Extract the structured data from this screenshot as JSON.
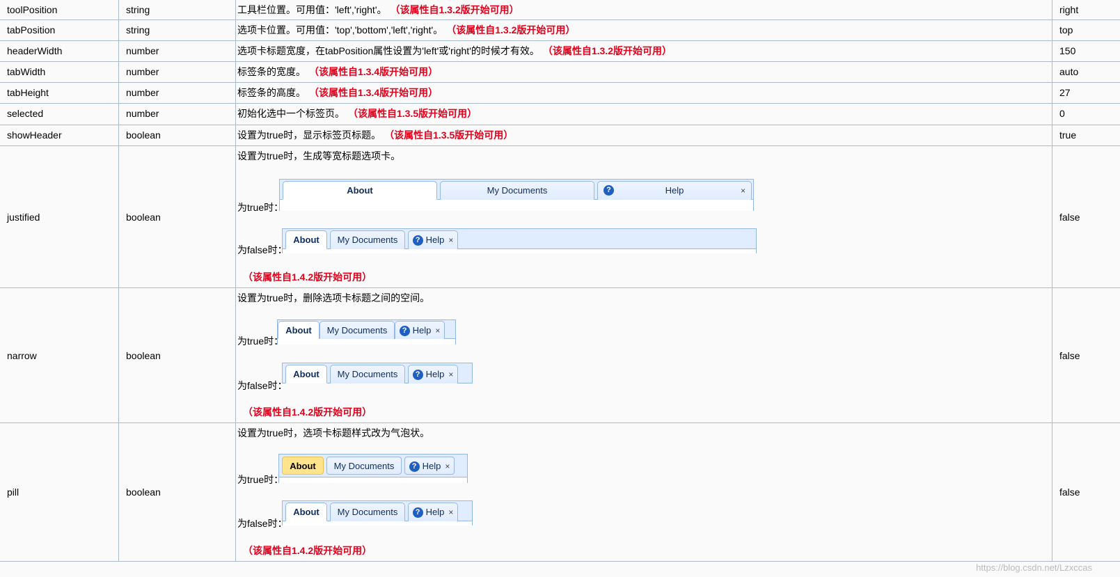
{
  "rows": [
    {
      "name": "toolPosition",
      "type": "string",
      "desc": "工具栏位置。可用值：'left','right'。",
      "note": "（该属性自1.3.2版开始可用）",
      "default": "right"
    },
    {
      "name": "tabPosition",
      "type": "string",
      "desc": "选项卡位置。可用值：'top','bottom','left','right'。",
      "note": "（该属性自1.3.2版开始可用）",
      "default": "top"
    },
    {
      "name": "headerWidth",
      "type": "number",
      "desc": "选项卡标题宽度，在tabPosition属性设置为'left'或'right'的时候才有效。",
      "note": "（该属性自1.3.2版开始可用）",
      "default": "150"
    },
    {
      "name": "tabWidth",
      "type": "number",
      "desc": "标签条的宽度。",
      "note": "（该属性自1.3.4版开始可用）",
      "default": "auto"
    },
    {
      "name": "tabHeight",
      "type": "number",
      "desc": "标签条的高度。",
      "note": "（该属性自1.3.4版开始可用）",
      "default": "27"
    },
    {
      "name": "selected",
      "type": "number",
      "desc": "初始化选中一个标签页。",
      "note": "（该属性自1.3.5版开始可用）",
      "default": "0"
    },
    {
      "name": "showHeader",
      "type": "boolean",
      "desc": "设置为true时，显示标签页标题。",
      "note": "（该属性自1.3.5版开始可用）",
      "default": "true"
    }
  ],
  "complex": [
    {
      "name": "justified",
      "type": "boolean",
      "desc": "设置为true时，生成等宽标题选项卡。",
      "true_label": "为true时：",
      "false_label": "为false时：",
      "note": "（该属性自1.4.2版开始可用）",
      "default": "false"
    },
    {
      "name": "narrow",
      "type": "boolean",
      "desc": "设置为true时，删除选项卡标题之间的空间。",
      "true_label": "为true时：",
      "false_label": "为false时：",
      "note": "（该属性自1.4.2版开始可用）",
      "default": "false"
    },
    {
      "name": "pill",
      "type": "boolean",
      "desc": "设置为true时，选项卡标题样式改为气泡状。",
      "true_label": "为true时：",
      "false_label": "为false时：",
      "note": "（该属性自1.4.2版开始可用）",
      "default": "false"
    }
  ],
  "tabs": {
    "about": "About",
    "docs": "My Documents",
    "help": "Help",
    "close": "×",
    "help_glyph": "?"
  },
  "watermark": "https://blog.csdn.net/Lzxccas",
  "colors": {
    "note": "#e3001b",
    "border": "#aabbd0",
    "tab_border": "#95b8e7",
    "tab_bg": "#e0ecff",
    "pill_selected": "#ffe48d",
    "help_icon": "#1f5fc0"
  }
}
